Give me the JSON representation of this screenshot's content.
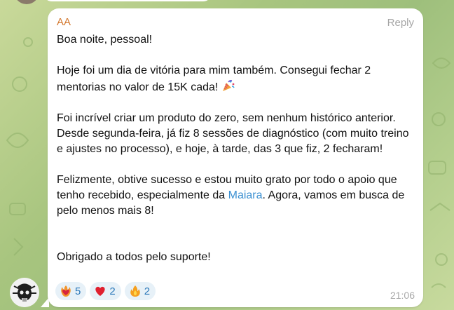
{
  "message": {
    "sender": "AA",
    "reply_label": "Reply",
    "paragraphs": {
      "p1": "Boa noite, pessoal!",
      "p2": "Hoje foi um dia de vitória para mim também. Consegui fechar 2 mentorias no valor de 15K cada!",
      "p3": "Foi incrível criar um produto do zero, sem nenhum histórico anterior. Desde segunda-feira, já fiz 8 sessões de diagnóstico (com muito treino e ajustes no processo), e hoje, à tarde, das 3 que fiz, 2 fecharam!",
      "p4_before": "Felizmente, obtive sucesso e estou muito grato por todo o apoio que tenho recebido, especialmente da ",
      "p4_mention": "Maiara",
      "p4_after": ". Agora, vamos em busca de pelo menos mais 8!",
      "p5": "Obrigado a todos pelo suporte!"
    },
    "time": "21:06",
    "reactions": [
      {
        "icon": "heart-on-fire-icon",
        "count": "5"
      },
      {
        "icon": "red-heart-icon",
        "count": "2"
      },
      {
        "icon": "fire-icon",
        "count": "2"
      }
    ]
  },
  "colors": {
    "sender": "#d3782f",
    "mention": "#3a8fd1",
    "reaction_bg": "#e7f1f8",
    "reaction_count": "#2b78b9"
  }
}
